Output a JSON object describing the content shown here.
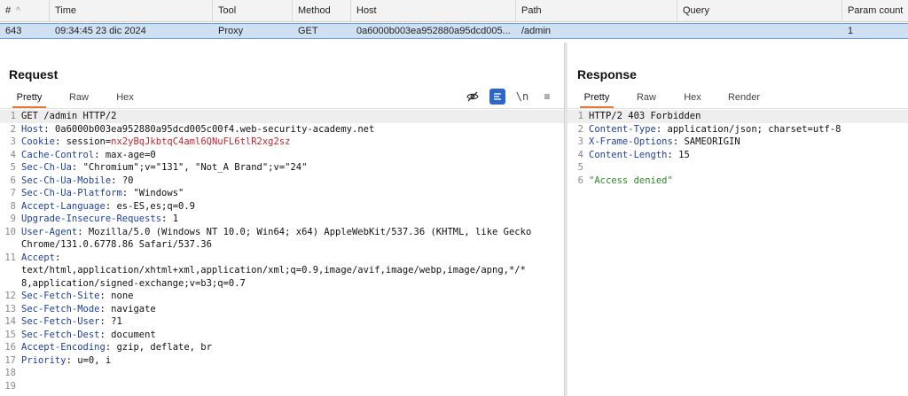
{
  "table": {
    "columns": [
      {
        "key": "num",
        "label": "#"
      },
      {
        "key": "time",
        "label": "Time"
      },
      {
        "key": "tool",
        "label": "Tool"
      },
      {
        "key": "method",
        "label": "Method"
      },
      {
        "key": "host",
        "label": "Host"
      },
      {
        "key": "path",
        "label": "Path"
      },
      {
        "key": "query",
        "label": "Query"
      },
      {
        "key": "param",
        "label": "Param count"
      }
    ],
    "row": {
      "num": "643",
      "time": "09:34:45 23 dic 2024",
      "tool": "Proxy",
      "method": "GET",
      "host": "0a6000b003ea952880a95dcd005...",
      "path": "/admin",
      "query": "",
      "param": "1"
    }
  },
  "request": {
    "title": "Request",
    "tabs": [
      "Pretty",
      "Raw",
      "Hex"
    ],
    "lines": [
      {
        "n": "1",
        "name": "",
        "sep": "",
        "value": "GET /admin HTTP/2"
      },
      {
        "n": "2",
        "name": "Host",
        "sep": ": ",
        "value": "0a6000b003ea952880a95dcd005c00f4.web-security-academy.net"
      },
      {
        "n": "3",
        "name": "Cookie",
        "sep": ": ",
        "value": "session=",
        "cookie": "nx2yBqJkbtqC4aml6QNuFL6tlR2xg2sz"
      },
      {
        "n": "4",
        "name": "Cache-Control",
        "sep": ": ",
        "value": "max-age=0"
      },
      {
        "n": "5",
        "name": "Sec-Ch-Ua",
        "sep": ": ",
        "value": "\"Chromium\";v=\"131\", \"Not_A Brand\";v=\"24\""
      },
      {
        "n": "6",
        "name": "Sec-Ch-Ua-Mobile",
        "sep": ": ",
        "value": "?0"
      },
      {
        "n": "7",
        "name": "Sec-Ch-Ua-Platform",
        "sep": ": ",
        "value": "\"Windows\""
      },
      {
        "n": "8",
        "name": "Accept-Language",
        "sep": ": ",
        "value": "es-ES,es;q=0.9"
      },
      {
        "n": "9",
        "name": "Upgrade-Insecure-Requests",
        "sep": ": ",
        "value": "1"
      },
      {
        "n": "10",
        "name": "User-Agent",
        "sep": ": ",
        "value": "Mozilla/5.0 (Windows NT 10.0; Win64; x64) AppleWebKit/537.36 (KHTML, like Gecko"
      },
      {
        "n": "",
        "name": "",
        "sep": "",
        "value": "Chrome/131.0.6778.86 Safari/537.36"
      },
      {
        "n": "11",
        "name": "Accept",
        "sep": ":",
        "value": ""
      },
      {
        "n": "",
        "name": "",
        "sep": "",
        "value": "text/html,application/xhtml+xml,application/xml;q=0.9,image/avif,image/webp,image/apng,*/*"
      },
      {
        "n": "",
        "name": "",
        "sep": "",
        "value": "8,application/signed-exchange;v=b3;q=0.7"
      },
      {
        "n": "12",
        "name": "Sec-Fetch-Site",
        "sep": ": ",
        "value": "none"
      },
      {
        "n": "13",
        "name": "Sec-Fetch-Mode",
        "sep": ": ",
        "value": "navigate"
      },
      {
        "n": "14",
        "name": "Sec-Fetch-User",
        "sep": ": ",
        "value": "?1"
      },
      {
        "n": "15",
        "name": "Sec-Fetch-Dest",
        "sep": ": ",
        "value": "document"
      },
      {
        "n": "16",
        "name": "Accept-Encoding",
        "sep": ": ",
        "value": "gzip, deflate, br"
      },
      {
        "n": "17",
        "name": "Priority",
        "sep": ": ",
        "value": "u=0, i"
      },
      {
        "n": "18",
        "name": "",
        "sep": "",
        "value": ""
      },
      {
        "n": "19",
        "name": "",
        "sep": "",
        "value": ""
      }
    ]
  },
  "response": {
    "title": "Response",
    "tabs": [
      "Pretty",
      "Raw",
      "Hex",
      "Render"
    ],
    "lines": [
      {
        "n": "1",
        "name": "",
        "sep": "",
        "value": "HTTP/2 403 Forbidden"
      },
      {
        "n": "2",
        "name": "Content-Type",
        "sep": ": ",
        "value": "application/json; charset=utf-8"
      },
      {
        "n": "3",
        "name": "X-Frame-Options",
        "sep": ": ",
        "value": "SAMEORIGIN"
      },
      {
        "n": "4",
        "name": "Content-Length",
        "sep": ": ",
        "value": "15"
      },
      {
        "n": "5",
        "name": "",
        "sep": "",
        "value": ""
      },
      {
        "n": "6",
        "name": "",
        "sep": "",
        "value": "",
        "body": "\"Access denied\""
      }
    ]
  },
  "toolbar": {
    "wrap_label": "\\n",
    "menu_label": "≡"
  }
}
